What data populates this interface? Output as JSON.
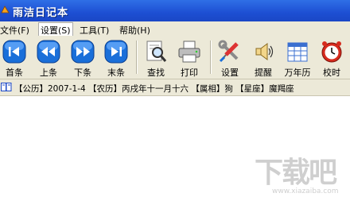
{
  "window": {
    "title": "雨洁日记本"
  },
  "menu": [
    {
      "label": "文件(F)"
    },
    {
      "label": "设置(S)"
    },
    {
      "label": "工具(T)"
    },
    {
      "label": "帮助(H)"
    }
  ],
  "toolbar": {
    "first": "首条",
    "prev": "上条",
    "next": "下条",
    "last": "末条",
    "find": "查找",
    "print": "打印",
    "settings": "设置",
    "remind": "提醒",
    "calendar": "万年历",
    "clock": "校时"
  },
  "status": {
    "text": "【公历】2007-1-4 【农历】丙戌年十一月十六 【属相】狗 【星座】魔羯座"
  },
  "watermark": {
    "text": "下载吧",
    "url": "www.xiazaiba.com"
  },
  "colors": {
    "title_bar": "#1d4fd3",
    "nav_button": "#1a6fd9",
    "chrome": "#ece9d8"
  }
}
